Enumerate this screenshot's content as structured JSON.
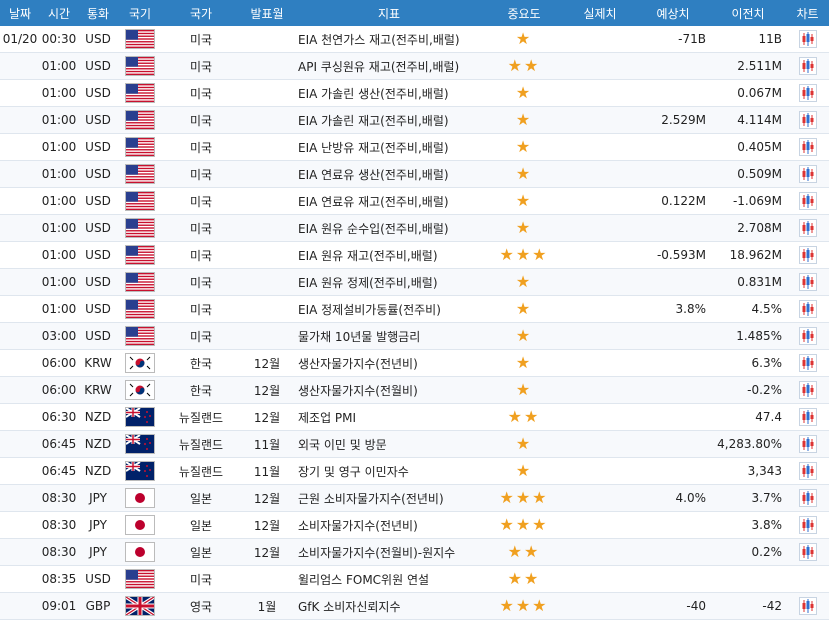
{
  "headers": {
    "date": "날짜",
    "time": "시간",
    "currency": "통화",
    "flag": "국기",
    "country": "국가",
    "period": "발표월",
    "indicator": "지표",
    "importance": "중요도",
    "actual": "실제치",
    "forecast": "예상치",
    "previous": "이전치",
    "chart": "차트"
  },
  "rows": [
    {
      "date": "01/20",
      "time": "00:30",
      "currency": "USD",
      "flag": "us-flag",
      "country": "미국",
      "period": "",
      "indicator": "EIA 천연가스 재고(전주비,배럴)",
      "stars": "★",
      "actual": "",
      "forecast": "-71B",
      "previous": "11B"
    },
    {
      "date": "",
      "time": "01:00",
      "currency": "USD",
      "flag": "us-flag",
      "country": "미국",
      "period": "",
      "indicator": "API 쿠싱원유 재고(전주비,배럴)",
      "stars": "★★",
      "actual": "",
      "forecast": "",
      "previous": "2.511M"
    },
    {
      "date": "",
      "time": "01:00",
      "currency": "USD",
      "flag": "us-flag",
      "country": "미국",
      "period": "",
      "indicator": "EIA 가솔린 생산(전주비,배럴)",
      "stars": "★",
      "actual": "",
      "forecast": "",
      "previous": "0.067M"
    },
    {
      "date": "",
      "time": "01:00",
      "currency": "USD",
      "flag": "us-flag",
      "country": "미국",
      "period": "",
      "indicator": "EIA 가솔린 재고(전주비,배럴)",
      "stars": "★",
      "actual": "",
      "forecast": "2.529M",
      "previous": "4.114M"
    },
    {
      "date": "",
      "time": "01:00",
      "currency": "USD",
      "flag": "us-flag",
      "country": "미국",
      "period": "",
      "indicator": "EIA 난방유 재고(전주비,배럴)",
      "stars": "★",
      "actual": "",
      "forecast": "",
      "previous": "0.405M"
    },
    {
      "date": "",
      "time": "01:00",
      "currency": "USD",
      "flag": "us-flag",
      "country": "미국",
      "period": "",
      "indicator": "EIA 연료유 생산(전주비,배럴)",
      "stars": "★",
      "actual": "",
      "forecast": "",
      "previous": "0.509M"
    },
    {
      "date": "",
      "time": "01:00",
      "currency": "USD",
      "flag": "us-flag",
      "country": "미국",
      "period": "",
      "indicator": "EIA 연료유 재고(전주비,배럴)",
      "stars": "★",
      "actual": "",
      "forecast": "0.122M",
      "previous": "-1.069M"
    },
    {
      "date": "",
      "time": "01:00",
      "currency": "USD",
      "flag": "us-flag",
      "country": "미국",
      "period": "",
      "indicator": "EIA 원유 순수입(전주비,배럴)",
      "stars": "★",
      "actual": "",
      "forecast": "",
      "previous": "2.708M"
    },
    {
      "date": "",
      "time": "01:00",
      "currency": "USD",
      "flag": "us-flag",
      "country": "미국",
      "period": "",
      "indicator": "EIA 원유 재고(전주비,배럴)",
      "stars": "★★★",
      "actual": "",
      "forecast": "-0.593M",
      "previous": "18.962M"
    },
    {
      "date": "",
      "time": "01:00",
      "currency": "USD",
      "flag": "us-flag",
      "country": "미국",
      "period": "",
      "indicator": "EIA 원유 정제(전주비,배럴)",
      "stars": "★",
      "actual": "",
      "forecast": "",
      "previous": "0.831M"
    },
    {
      "date": "",
      "time": "01:00",
      "currency": "USD",
      "flag": "us-flag",
      "country": "미국",
      "period": "",
      "indicator": "EIA 정제설비가동률(전주비)",
      "stars": "★",
      "actual": "",
      "forecast": "3.8%",
      "previous": "4.5%"
    },
    {
      "date": "",
      "time": "03:00",
      "currency": "USD",
      "flag": "us-flag",
      "country": "미국",
      "period": "",
      "indicator": "물가채 10년물 발행금리",
      "stars": "★",
      "actual": "",
      "forecast": "",
      "previous": "1.485%"
    },
    {
      "date": "",
      "time": "06:00",
      "currency": "KRW",
      "flag": "kr-flag",
      "country": "한국",
      "period": "12월",
      "indicator": "생산자물가지수(전년비)",
      "stars": "★",
      "actual": "",
      "forecast": "",
      "previous": "6.3%"
    },
    {
      "date": "",
      "time": "06:00",
      "currency": "KRW",
      "flag": "kr-flag",
      "country": "한국",
      "period": "12월",
      "indicator": "생산자물가지수(전월비)",
      "stars": "★",
      "actual": "",
      "forecast": "",
      "previous": "-0.2%"
    },
    {
      "date": "",
      "time": "06:30",
      "currency": "NZD",
      "flag": "nz-flag",
      "country": "뉴질랜드",
      "period": "12월",
      "indicator": "제조업 PMI",
      "stars": "★★",
      "actual": "",
      "forecast": "",
      "previous": "47.4"
    },
    {
      "date": "",
      "time": "06:45",
      "currency": "NZD",
      "flag": "nz-flag",
      "country": "뉴질랜드",
      "period": "11월",
      "indicator": "외국 이민 및 방문",
      "stars": "★",
      "actual": "",
      "forecast": "",
      "previous": "4,283.80%"
    },
    {
      "date": "",
      "time": "06:45",
      "currency": "NZD",
      "flag": "nz-flag",
      "country": "뉴질랜드",
      "period": "11월",
      "indicator": "장기 및 영구 이민자수",
      "stars": "★",
      "actual": "",
      "forecast": "",
      "previous": "3,343"
    },
    {
      "date": "",
      "time": "08:30",
      "currency": "JPY",
      "flag": "jp-flag",
      "country": "일본",
      "period": "12월",
      "indicator": "근원 소비자물가지수(전년비)",
      "stars": "★★★",
      "actual": "",
      "forecast": "4.0%",
      "previous": "3.7%"
    },
    {
      "date": "",
      "time": "08:30",
      "currency": "JPY",
      "flag": "jp-flag",
      "country": "일본",
      "period": "12월",
      "indicator": "소비자물가지수(전년비)",
      "stars": "★★★",
      "actual": "",
      "forecast": "",
      "previous": "3.8%"
    },
    {
      "date": "",
      "time": "08:30",
      "currency": "JPY",
      "flag": "jp-flag",
      "country": "일본",
      "period": "12월",
      "indicator": "소비자물가지수(전월비)-원지수",
      "stars": "★★",
      "actual": "",
      "forecast": "",
      "previous": "0.2%"
    },
    {
      "date": "",
      "time": "08:35",
      "currency": "USD",
      "flag": "us-flag",
      "country": "미국",
      "period": "",
      "indicator": "윌리엄스 FOMC위원 연설",
      "stars": "★★",
      "actual": "",
      "forecast": "",
      "previous": "",
      "no_chart": true
    },
    {
      "date": "",
      "time": "09:01",
      "currency": "GBP",
      "flag": "gb-flag",
      "country": "영국",
      "period": "1월",
      "indicator": "GfK 소비자신뢰지수",
      "stars": "★★★",
      "actual": "",
      "forecast": "-40",
      "previous": "-42"
    }
  ],
  "colors": {
    "header_bg": "#2f7fc1",
    "star": "#f0a020"
  }
}
